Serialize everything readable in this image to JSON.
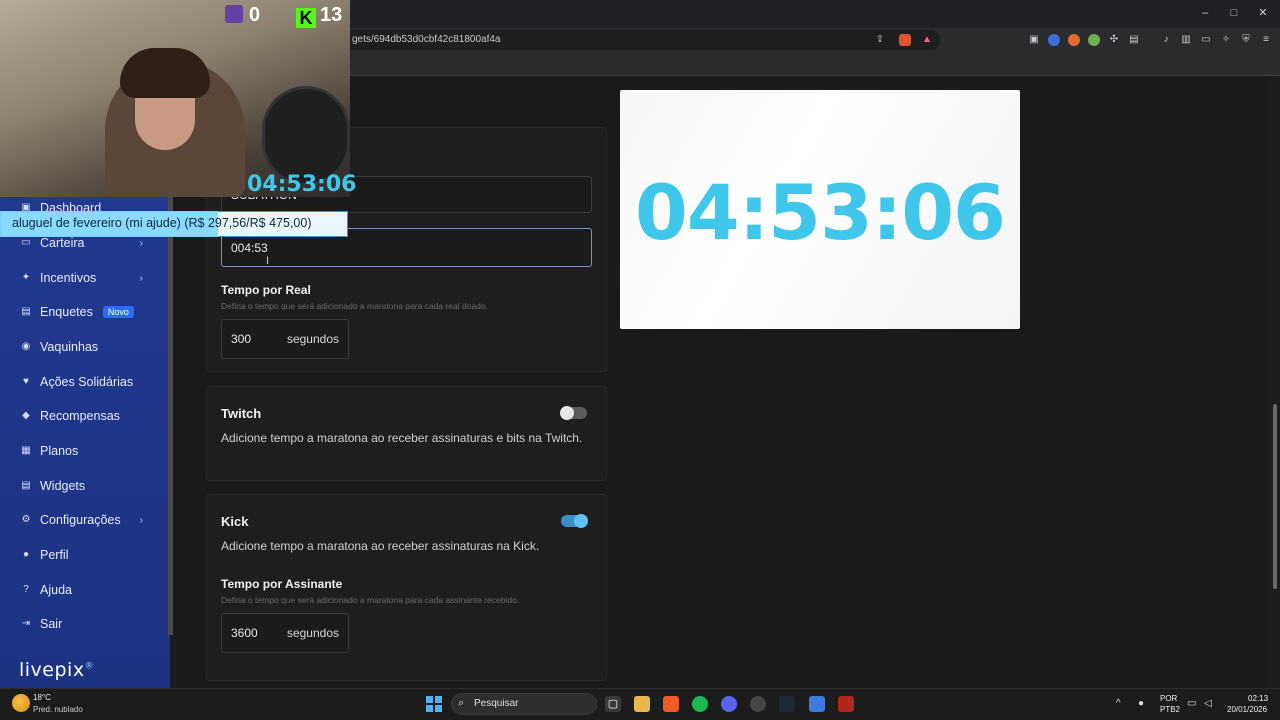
{
  "browser": {
    "url_fragment": "gets/694db53d0cbf42c81800af4a",
    "window_controls": {
      "minimize": "–",
      "maximize": "□",
      "close": "✕"
    }
  },
  "stream_overlay": {
    "twitch_count": "0",
    "kick_count": "13",
    "kick_icon_letter": "K",
    "timer": "04:53:06",
    "goal_text": "aluguel de fevereiro (mi ajude) (R$ 297,56/R$ 475,00)",
    "goal_progress": 0.626
  },
  "sidebar": {
    "items": [
      {
        "label": "Dashboard",
        "icon": "dashboard-icon",
        "glyph": "▣"
      },
      {
        "label": "Carteira",
        "icon": "wallet-icon",
        "glyph": "▭",
        "chevron": "›"
      },
      {
        "label": "Incentivos",
        "icon": "incentives-icon",
        "glyph": "✦",
        "chevron": "›"
      },
      {
        "label": "Enquetes",
        "icon": "poll-icon",
        "glyph": "▤",
        "badge": "Novo"
      },
      {
        "label": "Vaquinhas",
        "icon": "piggy-bank-icon",
        "glyph": "◉"
      },
      {
        "label": "Ações Solidárias",
        "icon": "charity-icon",
        "glyph": "♥"
      },
      {
        "label": "Recompensas",
        "icon": "reward-icon",
        "glyph": "◆"
      },
      {
        "label": "Planos",
        "icon": "plans-icon",
        "glyph": "▦"
      },
      {
        "label": "Widgets",
        "icon": "widgets-icon",
        "glyph": "▤"
      },
      {
        "label": "Configurações",
        "icon": "gear-icon",
        "glyph": "⚙",
        "chevron": "›"
      },
      {
        "label": "Perfil",
        "icon": "user-icon",
        "glyph": "●"
      },
      {
        "label": "Ajuda",
        "icon": "help-icon",
        "glyph": "?"
      },
      {
        "label": "Sair",
        "icon": "logout-icon",
        "glyph": "⇥"
      }
    ],
    "logo": "livepix",
    "logo_mark": "®"
  },
  "form": {
    "name_value": "SUBATHON",
    "time_value": "004:53",
    "tempo_por_real": {
      "label": "Tempo por Real",
      "hint": "Defina o tempo que será adicionado a maratona para cada real doado.",
      "value": "300",
      "unit": "segundos"
    },
    "twitch": {
      "title": "Twitch",
      "desc": "Adicione tempo a maratona ao receber assinaturas e bits na Twitch.",
      "enabled": false
    },
    "kick": {
      "title": "Kick",
      "desc": "Adicione tempo a maratona ao receber assinaturas na Kick.",
      "enabled": true,
      "tempo_label": "Tempo por Assinante",
      "tempo_hint": "Defina o tempo que será adicionado a maratona para cada assinante recebido.",
      "value": "3600",
      "unit": "segundos"
    }
  },
  "preview": {
    "time": "04:53:06"
  },
  "taskbar": {
    "weather_temp": "18°C",
    "weather_desc": "Pred. nublado",
    "search_placeholder": "Pesquisar",
    "lang1": "POR",
    "lang2": "PTB2",
    "time": "02:13",
    "date": "20/01/2026"
  },
  "colors": {
    "accent": "#3ec7ea",
    "sidebar": "#21398f",
    "toggle_on": "#3b8fc9"
  }
}
